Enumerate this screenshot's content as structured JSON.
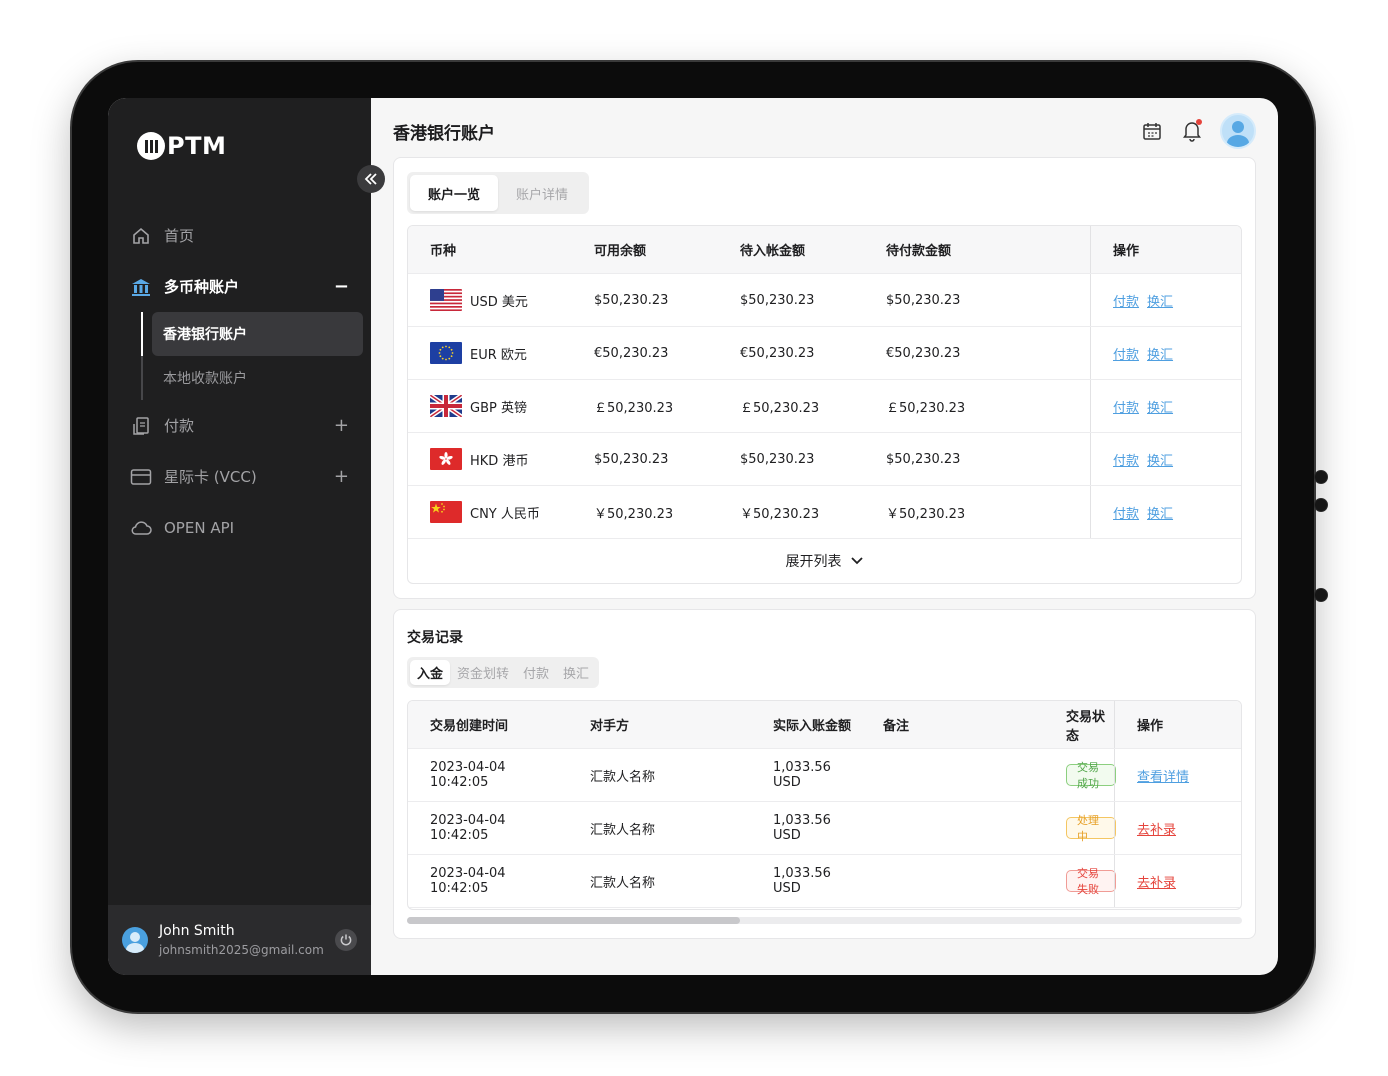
{
  "brand": {
    "logo_text": "PTM"
  },
  "sidebar": {
    "items": [
      {
        "label": "首页",
        "icon": "home-icon"
      },
      {
        "label": "多币种账户",
        "icon": "bank-icon",
        "trail": "−"
      },
      {
        "label": "付款",
        "icon": "payment-icon",
        "trail": "+"
      },
      {
        "label": "星际卡 (VCC)",
        "icon": "card-icon",
        "trail": "+"
      },
      {
        "label": "OPEN API",
        "icon": "cloud-icon"
      }
    ],
    "sub_items": [
      {
        "label": "香港银行账户"
      },
      {
        "label": "本地收款账户"
      }
    ]
  },
  "user": {
    "name": "John Smith",
    "email": "johnsmith2025@gmail.com"
  },
  "page": {
    "title": "香港银行账户"
  },
  "account_tabs": [
    {
      "label": "账户一览"
    },
    {
      "label": "账户详情"
    }
  ],
  "accounts_table": {
    "headers": {
      "currency": "币种",
      "available": "可用余额",
      "pending_in": "待入帐金额",
      "pending_out": "待付款金额",
      "actions": "操作"
    },
    "rows": [
      {
        "flag": "us",
        "currency": "USD 美元",
        "available": "$50,230.23",
        "pending_in": "$50,230.23",
        "pending_out": "$50,230.23",
        "pay": "付款",
        "exchange": "换汇"
      },
      {
        "flag": "eu",
        "currency": "EUR 欧元",
        "available": "€50,230.23",
        "pending_in": "€50,230.23",
        "pending_out": "€50,230.23",
        "pay": "付款",
        "exchange": "换汇"
      },
      {
        "flag": "gb",
        "currency": "GBP 英镑",
        "available": "￡50,230.23",
        "pending_in": "￡50,230.23",
        "pending_out": "￡50,230.23",
        "pay": "付款",
        "exchange": "换汇"
      },
      {
        "flag": "hk",
        "currency": "HKD 港币",
        "available": "$50,230.23",
        "pending_in": "$50,230.23",
        "pending_out": "$50,230.23",
        "pay": "付款",
        "exchange": "换汇"
      },
      {
        "flag": "cn",
        "currency": "CNY 人民币",
        "available": "￥50,230.23",
        "pending_in": "￥50,230.23",
        "pending_out": "￥50,230.23",
        "pay": "付款",
        "exchange": "换汇"
      }
    ],
    "expand_label": "展开列表"
  },
  "transactions": {
    "title": "交易记录",
    "tabs": [
      {
        "label": "入金"
      },
      {
        "label": "资金划转"
      },
      {
        "label": "付款"
      },
      {
        "label": "换汇"
      }
    ],
    "headers": {
      "created": "交易创建时间",
      "counterparty": "对手方",
      "amount": "实际入账金额",
      "note": "备注",
      "status": "交易状态",
      "actions": "操作"
    },
    "rows": [
      {
        "created": "2023-04-04 10:42:05",
        "counterparty": "汇款人名称",
        "amount": "1,033.56 USD",
        "status": "交易成功",
        "status_kind": "ok",
        "action": "查看详情"
      },
      {
        "created": "2023-04-04 10:42:05",
        "counterparty": "汇款人名称",
        "amount": "1,033.56 USD",
        "status": "处理中",
        "status_kind": "pending",
        "action": "去补录"
      },
      {
        "created": "2023-04-04 10:42:05",
        "counterparty": "汇款人名称",
        "amount": "1,033.56 USD",
        "status": "交易失败",
        "status_kind": "fail",
        "action": "去补录"
      }
    ]
  },
  "colors": {
    "sidebar_bg": "#1f1f20",
    "link_blue": "#4f9fe0",
    "success": "#52a64a",
    "warning": "#e7a12a",
    "danger": "#e5443c"
  }
}
